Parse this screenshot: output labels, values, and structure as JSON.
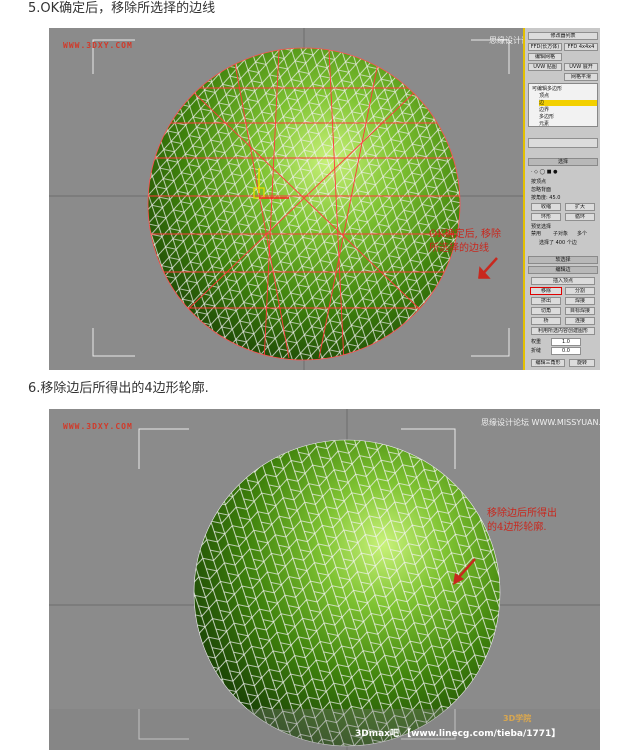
{
  "step5": {
    "title": "5.OK确定后，移除所选择的边线"
  },
  "step6": {
    "title": "6.移除边后所得出的4边形轮廓."
  },
  "shot1": {
    "site_watermark": "WWW.3DXY.COM",
    "forum_watermark": "思缘设计论坛 WWW.MISSYUAN.COM",
    "annotation_lines": [
      "OK确定后, 移除",
      "所选择的边线"
    ],
    "panel": {
      "top_rows": [
        "修改器列表",
        "FFD(长方体)",
        "FFD 4x4x4",
        "编辑网格",
        "UVW 贴图",
        "UVW 展开",
        "网格平滑"
      ],
      "stack_items": [
        "可编辑多边形",
        "顶点",
        "边",
        "边界",
        "多边形",
        "元素"
      ],
      "stack_selected_index": 2,
      "selection_rollout": "选择",
      "checkboxes": [
        "按顶点",
        "忽略背面",
        "按角度: 45.0"
      ],
      "buttons_shrink_grow": [
        "收缩",
        "扩大"
      ],
      "buttons_ring_loop": [
        "环形",
        "循环"
      ],
      "preview_label": "预览选择",
      "preview_options": [
        "禁用",
        "子对象",
        "多个"
      ],
      "selected_count": "选择了 400 个边",
      "soft_selection": "软选择",
      "edit_edges": "编辑边",
      "insert_vertex": "插入顶点",
      "remove": "移除",
      "split": "分割",
      "extrude": "挤出",
      "weld": "焊接",
      "chamfer": "切角",
      "target_weld": "目标焊接",
      "bridge": "桥",
      "connect": "连接",
      "create_shape": "利用所选内容创建图形",
      "weight_label": "权重",
      "weight_value": "1.0",
      "crease_label": "折缝",
      "crease_value": "0.0",
      "edit_tri": "编辑三角形",
      "rotate": "旋转"
    }
  },
  "shot2": {
    "site_watermark": "WWW.3DXY.COM",
    "forum_watermark": "思缘设计论坛 WWW.MISSYUAN.COM",
    "annotation_lines": [
      "移除边后所得出",
      "的4边形轮廓."
    ],
    "footer": "3Dmax吧 【www.linecg.com/tieba/1771】",
    "logo": "3D学院"
  },
  "colors": {
    "viewport_bg": "#8b8b8b",
    "sphere_light": "#c9f27a",
    "sphere_mid": "#4f9a10",
    "sphere_dark": "#173d05",
    "wire_white": "#f4f4f4",
    "selected_edge_red": "#ff3b3b",
    "annotation_red": "#c8281e",
    "panel_bg": "#c8c8c8",
    "highlight_yellow": "#f3d000"
  }
}
